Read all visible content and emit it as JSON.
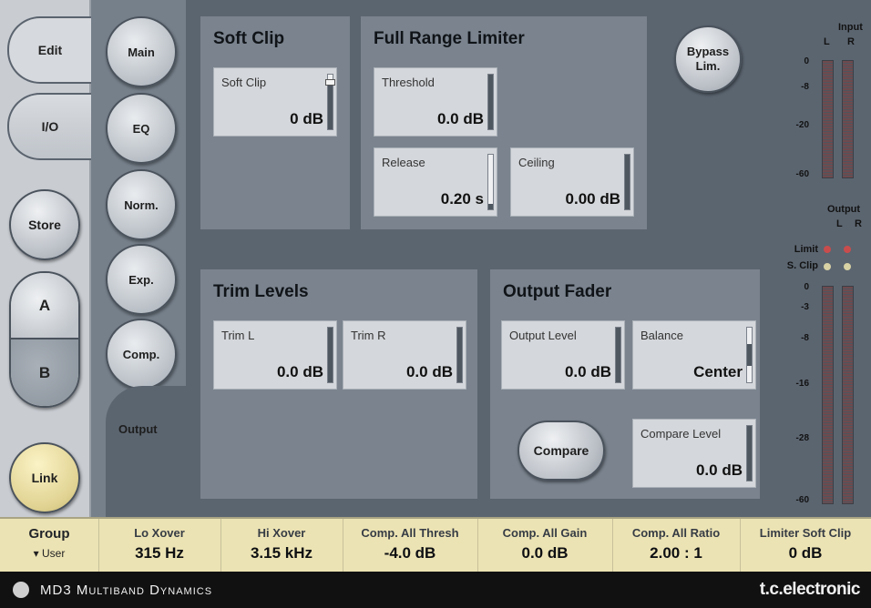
{
  "left_tabs": {
    "edit": "Edit",
    "io": "I/O",
    "store": "Store",
    "a": "A",
    "b": "B",
    "link": "Link"
  },
  "func_tabs": {
    "main": "Main",
    "eq": "EQ",
    "norm": "Norm.",
    "exp": "Exp.",
    "comp": "Comp.",
    "output": "Output"
  },
  "soft_clip": {
    "title": "Soft Clip",
    "param": {
      "label": "Soft Clip",
      "value": "0 dB",
      "level": 0.85
    }
  },
  "limiter": {
    "title": "Full Range Limiter",
    "bypass": "Bypass Lim.",
    "threshold": {
      "label": "Threshold",
      "value": "0.0 dB",
      "level": 1.0
    },
    "release": {
      "label": "Release",
      "value": "0.20 s",
      "level": 0.1
    },
    "ceiling": {
      "label": "Ceiling",
      "value": "0.00 dB",
      "level": 1.0
    }
  },
  "trim": {
    "title": "Trim Levels",
    "left": {
      "label": "Trim L",
      "value": "0.0 dB",
      "level": 1.0
    },
    "right": {
      "label": "Trim R",
      "value": "0.0 dB",
      "level": 1.0
    }
  },
  "output_fader": {
    "title": "Output Fader",
    "output_level": {
      "label": "Output Level",
      "value": "0.0 dB",
      "level": 1.0
    },
    "balance": {
      "label": "Balance",
      "value": "Center",
      "level": 0.5
    },
    "compare_button": "Compare",
    "compare_level": {
      "label": "Compare Level",
      "value": "0.0 dB",
      "level": 1.0
    }
  },
  "meters": {
    "input": {
      "title": "Input",
      "l": "L",
      "r": "R",
      "ticks": [
        "0",
        "-8",
        "-20",
        "-60"
      ]
    },
    "output": {
      "title": "Output",
      "l": "L",
      "r": "R",
      "limit": "Limit",
      "sclip": "S. Clip",
      "ticks": [
        "0",
        "-3",
        "-8",
        "-16",
        "-28",
        "-60"
      ]
    },
    "colors": {
      "limit_led": "#c94c4c",
      "sclip_led": "#d8d2a4"
    }
  },
  "footer": {
    "group": {
      "label": "Group",
      "value": "▾ User"
    },
    "cells": [
      {
        "label": "Lo Xover",
        "value": "315 Hz"
      },
      {
        "label": "Hi Xover",
        "value": "3.15 kHz"
      },
      {
        "label": "Comp. All Thresh",
        "value": "-4.0 dB"
      },
      {
        "label": "Comp. All Gain",
        "value": "0.0 dB"
      },
      {
        "label": "Comp. All Ratio",
        "value": "2.00 : 1"
      },
      {
        "label": "Limiter Soft Clip",
        "value": "0 dB"
      }
    ]
  },
  "brand": {
    "title": "MD3 Multiband Dynamics",
    "maker": "t.c.electronic"
  }
}
